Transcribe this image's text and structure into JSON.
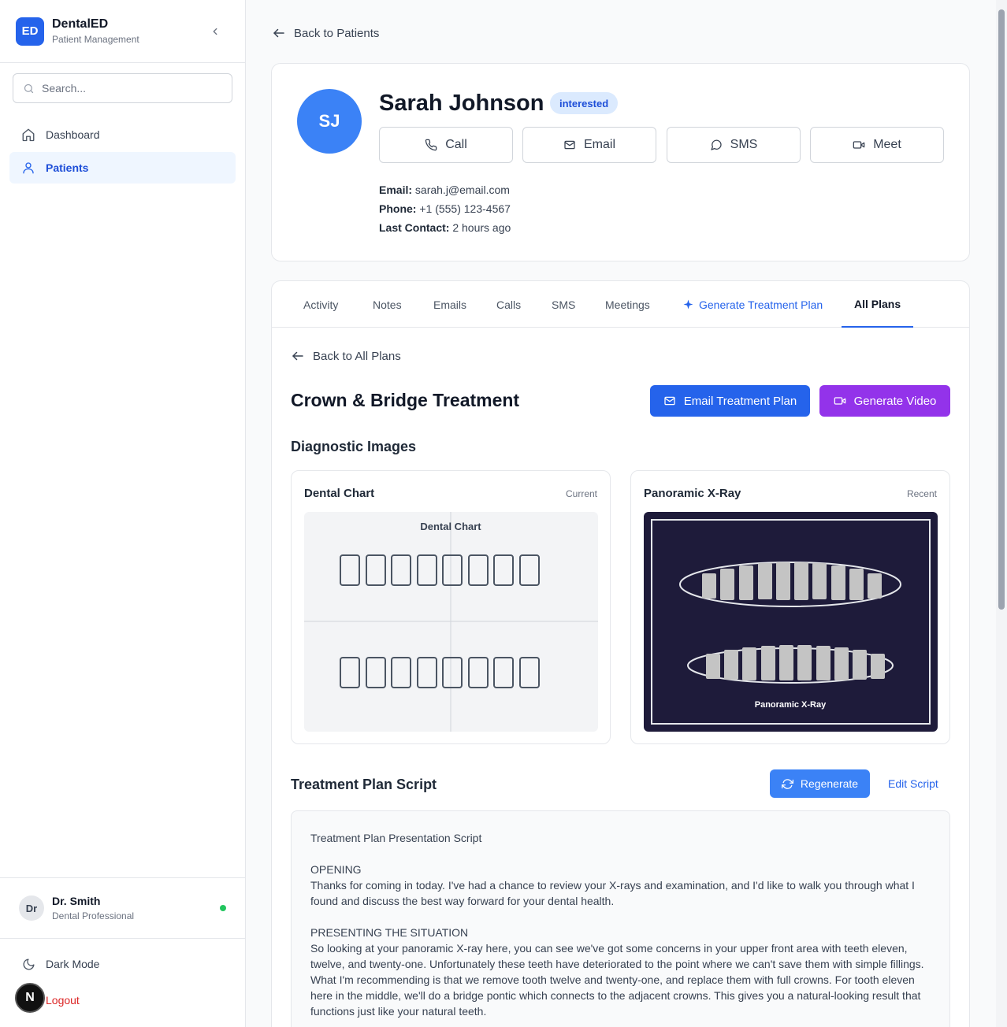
{
  "brand": {
    "logo": "ED",
    "title": "DentalED",
    "subtitle": "Patient Management"
  },
  "search": {
    "placeholder": "Search..."
  },
  "nav": [
    {
      "label": "Dashboard",
      "icon": "home-icon"
    },
    {
      "label": "Patients",
      "icon": "user-icon",
      "active": true
    }
  ],
  "user": {
    "initials": "Dr",
    "name": "Dr. Smith",
    "role": "Dental Professional",
    "status_color": "#22c55e"
  },
  "sidebar_bottom": {
    "dark_mode": "Dark Mode",
    "logout": "Logout",
    "badge": "N"
  },
  "back_to_patients": "Back to Patients",
  "patient": {
    "initials": "SJ",
    "name": "Sarah Johnson",
    "status": "interested",
    "actions": [
      "Call",
      "Email",
      "SMS",
      "Meet"
    ],
    "email_label": "Email:",
    "email": "sarah.j@email.com",
    "phone_label": "Phone:",
    "phone": "+1 (555) 123-4567",
    "last_contact_label": "Last Contact:",
    "last_contact": "2 hours ago"
  },
  "tabs": [
    "Activity",
    "Notes",
    "Emails",
    "Calls",
    "SMS",
    "Meetings",
    "Generate Treatment Plan",
    "All Plans"
  ],
  "active_tab": "All Plans",
  "plan": {
    "back": "Back to All Plans",
    "title": "Crown & Bridge Treatment",
    "email_button": "Email Treatment Plan",
    "video_button": "Generate Video",
    "diagnostic_title": "Diagnostic Images",
    "images": [
      {
        "title": "Dental Chart",
        "tag": "Current",
        "inner_label": "Dental Chart"
      },
      {
        "title": "Panoramic X-Ray",
        "tag": "Recent",
        "inner_label": "Panoramic X-Ray"
      }
    ],
    "script_title": "Treatment Plan Script",
    "regenerate": "Regenerate",
    "edit_script": "Edit Script",
    "script": {
      "heading": "Treatment Plan Presentation Script",
      "opening_title": "OPENING",
      "opening_text": "Thanks for coming in today. I've had a chance to review your X-rays and examination, and I'd like to walk you through what I found and discuss the best way forward for your dental health.",
      "situation_title": "PRESENTING THE SITUATION",
      "situation_text": "So looking at your panoramic X-ray here, you can see we've got some concerns in your upper front area with teeth eleven, twelve, and twenty-one. Unfortunately these teeth have deteriorated to the point where we can't save them with simple fillings. What I'm recommending is that we remove tooth twelve and twenty-one, and replace them with full crowns. For tooth eleven here in the middle, we'll do a bridge pontic which connects to the adjacent crowns. This gives you a natural-looking result that functions just like your natural teeth."
    }
  },
  "colors": {
    "primary": "#2563eb",
    "purple": "#9333ea",
    "avatar": "#3b82f6",
    "logout": "#dc2626"
  }
}
